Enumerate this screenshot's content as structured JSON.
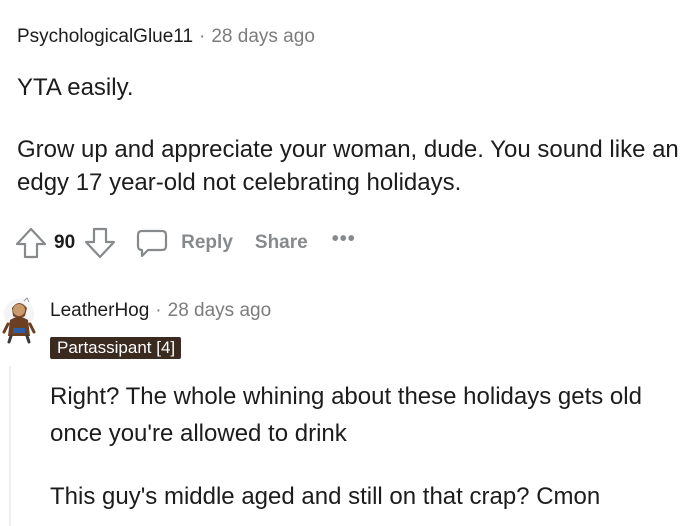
{
  "comment": {
    "author": "PsychologicalGlue11",
    "separator": "·",
    "time": "28 days ago",
    "paragraphs": [
      "YTA easily.",
      "Grow up and appreciate your woman, dude. You sound like an edgy 17 year-old not celebrating holidays."
    ],
    "actions": {
      "score": "90",
      "reply_label": "Reply",
      "share_label": "Share",
      "more_label": "•••",
      "upvote_icon": "upvote-arrow-icon",
      "downvote_icon": "downvote-arrow-icon",
      "reply_icon": "speech-bubble-icon"
    }
  },
  "reply": {
    "author": "LeatherHog",
    "separator": "·",
    "time": "28 days ago",
    "flair": "Partassipant [4]",
    "avatar_icon": "avatar-figure-icon",
    "paragraphs": [
      "Right? The whole whining about these holidays gets old once you're allowed to drink",
      "This guy's middle aged and still on that crap? Cmon"
    ]
  },
  "colors": {
    "text": "#1c1c1c",
    "muted": "#7c7c7c",
    "action_gray": "#878a8c",
    "flair_bg": "#3a2a20",
    "flair_text": "#ffffff",
    "thread_line": "#edeff1"
  }
}
